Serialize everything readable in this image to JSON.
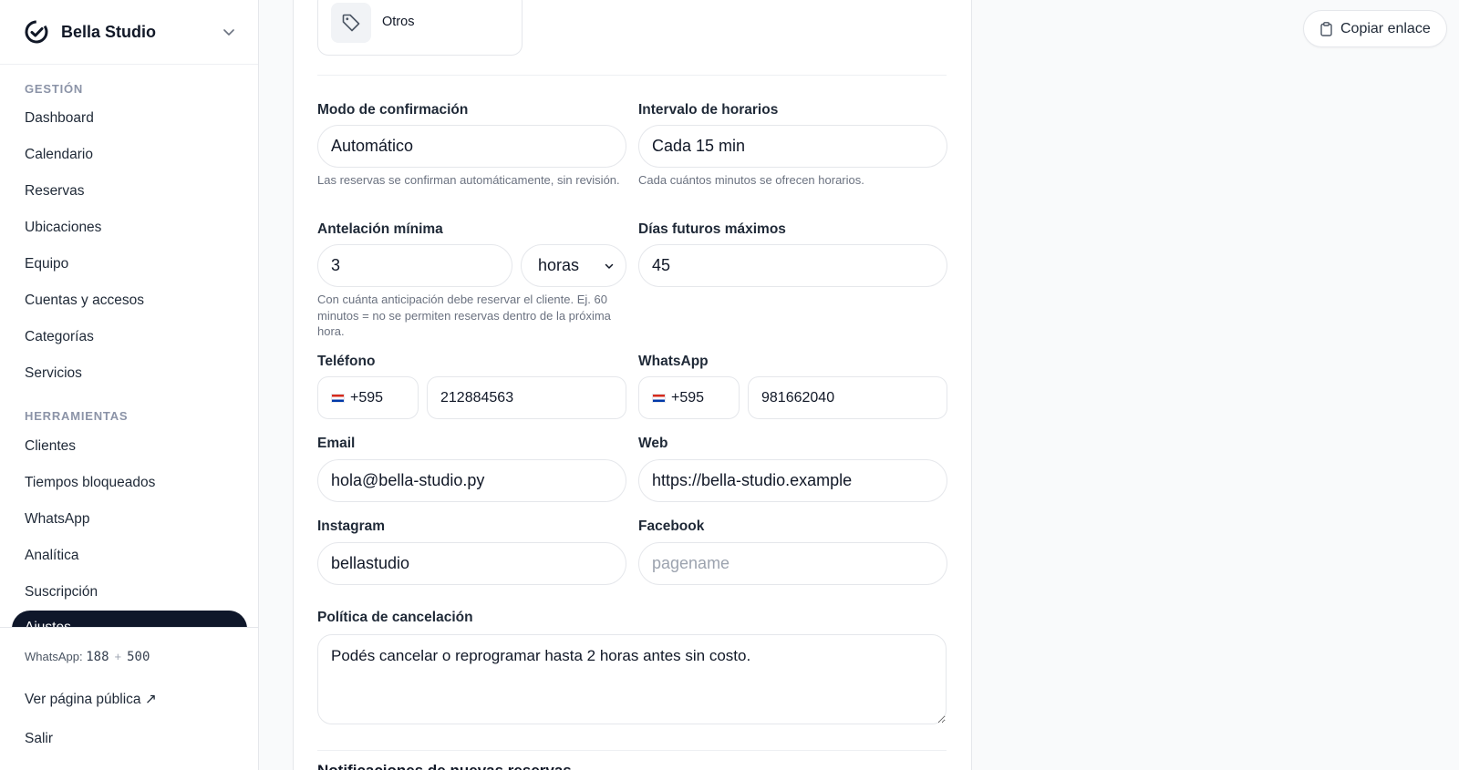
{
  "brand": {
    "name": "Bella Studio"
  },
  "sidebar": {
    "section_management": "GESTIÓN",
    "management_items": [
      "Dashboard",
      "Calendario",
      "Reservas",
      "Ubicaciones",
      "Equipo",
      "Cuentas y accesos",
      "Categorías",
      "Servicios"
    ],
    "section_tools": "HERRAMIENTAS",
    "tools_items": [
      "Clientes",
      "Tiempos bloqueados",
      "WhatsApp",
      "Analítica",
      "Suscripción"
    ],
    "active_item": "Ajustes",
    "footer": {
      "wa_label": "WhatsApp:",
      "wa_used": "188",
      "wa_plus": "+",
      "wa_total": "500",
      "public_page": "Ver página pública ↗",
      "logout": "Salir"
    }
  },
  "category": {
    "label": "Otros",
    "icon": "tag-icon"
  },
  "form": {
    "confirmation": {
      "label": "Modo de confirmación",
      "value": "Automático",
      "hint": "Las reservas se confirman automáticamente, sin revisión."
    },
    "interval": {
      "label": "Intervalo de horarios",
      "value": "Cada 15 min",
      "hint": "Cada cuántos minutos se ofrecen horarios."
    },
    "min_advance": {
      "label": "Antelación mínima",
      "value": "3",
      "unit": "horas",
      "hint": "Con cuánta anticipación debe reservar el cliente. Ej. 60 minutos = no se permiten reservas dentro de la próxima hora."
    },
    "max_future_days": {
      "label": "Días futuros máximos",
      "value": "45"
    },
    "phone": {
      "label": "Teléfono",
      "prefix": "+595",
      "value": "212884563"
    },
    "whatsapp": {
      "label": "WhatsApp",
      "prefix": "+595",
      "value": "981662040"
    },
    "email": {
      "label": "Email",
      "value": "hola@bella-studio.py"
    },
    "web": {
      "label": "Web",
      "value": "https://bella-studio.example"
    },
    "instagram": {
      "label": "Instagram",
      "value": "bellastudio"
    },
    "facebook": {
      "label": "Facebook",
      "value": "",
      "placeholder": "pagename"
    },
    "cancellation": {
      "label": "Política de cancelación",
      "value": "Podés cancelar o reprogramar hasta 2 horas antes sin costo."
    },
    "next_section": "Notificaciones de nuevas reservas"
  },
  "header": {
    "copy_link": "Copiar enlace"
  },
  "colors": {
    "active_bg": "#0f172a",
    "border": "#e5e7eb",
    "muted": "#6b7280",
    "flag_red": "#d52b1e",
    "flag_blue": "#0038a8"
  }
}
